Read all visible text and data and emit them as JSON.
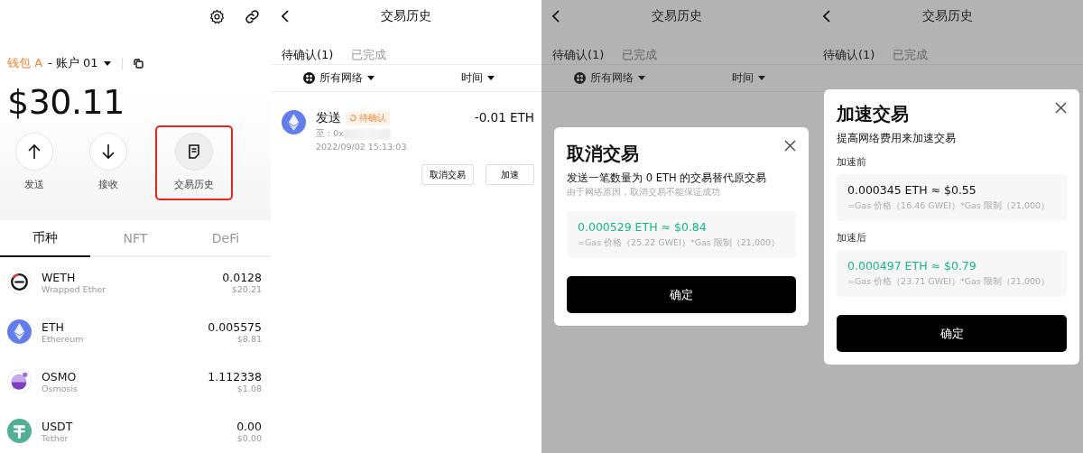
{
  "wallet": {
    "wallet_name": "钱包 A",
    "account": "- 账户 01",
    "balance": "$30.11",
    "actions": [
      {
        "label": "发送",
        "kind": "send",
        "highlighted": false
      },
      {
        "label": "接收",
        "kind": "receive",
        "highlighted": false
      },
      {
        "label": "交易历史",
        "kind": "history",
        "highlighted": true
      }
    ],
    "tabs": [
      {
        "label": "币种",
        "selected": true
      },
      {
        "label": "NFT",
        "selected": false
      },
      {
        "label": "DeFi",
        "selected": false
      }
    ],
    "tokens": [
      {
        "symbol": "WETH",
        "name": "Wrapped Ether",
        "amount": "0.0128",
        "value": "$20.21",
        "kind": "weth"
      },
      {
        "symbol": "ETH",
        "name": "Ethereum",
        "amount": "0.005575",
        "value": "$8.81",
        "kind": "eth"
      },
      {
        "symbol": "OSMO",
        "name": "Osmosis",
        "amount": "1.112338",
        "value": "$1.08",
        "kind": "osmo"
      },
      {
        "symbol": "USDT",
        "name": "Tether",
        "amount": "0.00",
        "value": "$0.00",
        "kind": "usdt"
      }
    ]
  },
  "history": {
    "title": "交易历史",
    "tabs": [
      {
        "label": "待确认(1)",
        "selected": true
      },
      {
        "label": "已完成",
        "selected": false
      }
    ],
    "filters": [
      "所有网络",
      "时间"
    ],
    "transactions": [
      {
        "type": "发送",
        "status": "待确认",
        "to": "至 : 0x",
        "time": "2022/09/02 15:13:03",
        "amount": "-0.01 ETH",
        "actions": [
          "取消交易",
          "加速"
        ]
      }
    ]
  },
  "cancel_screen": {
    "title": "交易历史",
    "tabs": [
      {
        "label": "待确认(1)",
        "selected": true
      },
      {
        "label": "已完成",
        "selected": false
      }
    ],
    "filters": [
      "所有网络",
      "时间"
    ],
    "dialog": {
      "title": "取消交易",
      "description": "发送一笔数量为 0 ETH 的交易替代原交易",
      "note": "由于网络原因，取消交易不能保证成功",
      "fees": [
        {
          "amount": "0.000529 ETH ≈ $0.84",
          "detail": "=Gas 价格（25.22 GWEI）*Gas 限制（21,000）",
          "highlighted": true
        }
      ],
      "confirm": "确定"
    }
  },
  "speedup_screen": {
    "title": "交易历史",
    "tabs": [
      {
        "label": "待确认(1)",
        "selected": true
      },
      {
        "label": "已完成",
        "selected": false
      }
    ],
    "dialog": {
      "title": "加速交易",
      "description": "提高网络费用来加速交易",
      "fees": [
        {
          "label": "加速前",
          "amount": "0.000345 ETH ≈ $0.55",
          "detail": "=Gas 价格（16.46 GWEI）*Gas 限制（21,000）",
          "highlighted": false
        },
        {
          "label": "加速后",
          "amount": "0.000497 ETH ≈ $0.79",
          "detail": "=Gas 价格（23.71 GWEI）*Gas 限制（21,000）",
          "highlighted": true
        }
      ],
      "confirm": "确定"
    }
  }
}
